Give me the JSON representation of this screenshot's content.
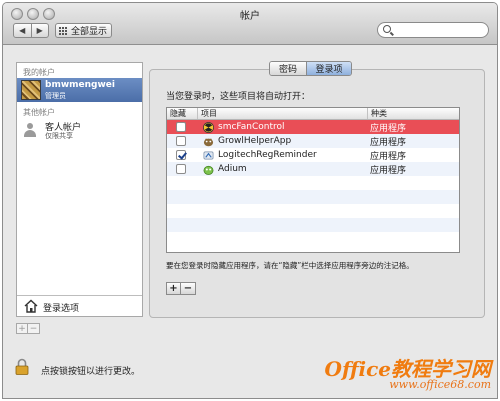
{
  "window": {
    "title": "帐户"
  },
  "toolbar": {
    "back_label": "◀",
    "forward_label": "▶",
    "show_all_label": "全部显示",
    "search_placeholder": ""
  },
  "sidebar": {
    "my_accounts_label": "我的帐户",
    "current_user": {
      "name": "bmwmengwei",
      "role": "管理员"
    },
    "other_accounts_label": "其他帐户",
    "guest": {
      "name": "客人帐户",
      "sub": "仅限共享"
    },
    "login_options_label": "登录选项",
    "add_label": "+",
    "remove_label": "−"
  },
  "tabs": [
    {
      "label": "密码",
      "active": false
    },
    {
      "label": "登录项",
      "active": true
    }
  ],
  "login_items": {
    "intro": "当您登录时，这些项目将自动打开：",
    "columns": [
      "隐藏",
      "项目",
      "种类"
    ],
    "rows": [
      {
        "hidden": false,
        "name": "smcFanControl",
        "kind": "应用程序",
        "icon": "fan-icon",
        "selected": true
      },
      {
        "hidden": false,
        "name": "GrowlHelperApp",
        "kind": "应用程序",
        "icon": "growl-icon",
        "selected": false
      },
      {
        "hidden": true,
        "name": "LogitechRegReminder",
        "kind": "应用程序",
        "icon": "logitech-icon",
        "selected": false
      },
      {
        "hidden": false,
        "name": "Adium",
        "kind": "应用程序",
        "icon": "adium-icon",
        "selected": false
      }
    ],
    "note": "要在您登录时隐藏应用程序，请在“隐藏”栏中选择应用程序旁边的注记格。",
    "add_label": "+",
    "remove_label": "−"
  },
  "footer": {
    "lock_text": "点按锁按钮以进行更改。",
    "watermark_main": "Office教程学习网",
    "watermark_url": "www.office68.com"
  },
  "colors": {
    "selection": "#e94e56",
    "sidebar_selection": "#5a7db7",
    "accent": "#f07c10"
  }
}
